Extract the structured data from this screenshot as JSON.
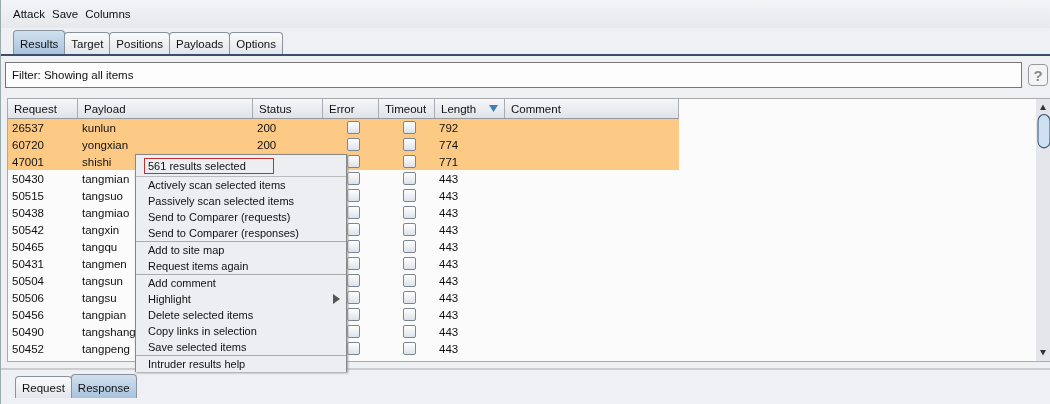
{
  "menu_bar": [
    "Attack",
    "Save",
    "Columns"
  ],
  "tabs": [
    {
      "label": "Results",
      "selected": true
    },
    {
      "label": "Target",
      "selected": false
    },
    {
      "label": "Positions",
      "selected": false
    },
    {
      "label": "Payloads",
      "selected": false
    },
    {
      "label": "Options",
      "selected": false
    }
  ],
  "filter": {
    "text": "Filter:  Showing all items",
    "help": "?"
  },
  "table": {
    "columns": [
      {
        "label": "Request",
        "sorted": false
      },
      {
        "label": "Payload",
        "sorted": false
      },
      {
        "label": "Status",
        "sorted": false
      },
      {
        "label": "Error",
        "sorted": false
      },
      {
        "label": "Timeout",
        "sorted": false
      },
      {
        "label": "Length",
        "sorted": true
      },
      {
        "label": "Comment",
        "sorted": false
      }
    ],
    "rows": [
      {
        "request": "26537",
        "payload": "kunlun",
        "status": "200",
        "error": false,
        "timeout": false,
        "length": "792",
        "selected": true
      },
      {
        "request": "60720",
        "payload": "yongxian",
        "status": "200",
        "error": false,
        "timeout": false,
        "length": "774",
        "selected": true
      },
      {
        "request": "47001",
        "payload": "shishi",
        "error": false,
        "timeout": false,
        "length": "771",
        "selected": true
      },
      {
        "request": "50430",
        "payload": "tangmian",
        "error": false,
        "timeout": false,
        "length": "443",
        "selected": false
      },
      {
        "request": "50515",
        "payload": "tangsuo",
        "error": false,
        "timeout": false,
        "length": "443",
        "selected": false
      },
      {
        "request": "50438",
        "payload": "tangmiao",
        "error": false,
        "timeout": false,
        "length": "443",
        "selected": false
      },
      {
        "request": "50542",
        "payload": "tangxin",
        "error": false,
        "timeout": false,
        "length": "443",
        "selected": false
      },
      {
        "request": "50465",
        "payload": "tangqu",
        "error": false,
        "timeout": false,
        "length": "443",
        "selected": false
      },
      {
        "request": "50431",
        "payload": "tangmen",
        "error": false,
        "timeout": false,
        "length": "443",
        "selected": false
      },
      {
        "request": "50504",
        "payload": "tangsun",
        "error": false,
        "timeout": false,
        "length": "443",
        "selected": false
      },
      {
        "request": "50506",
        "payload": "tangsu",
        "error": false,
        "timeout": false,
        "length": "443",
        "selected": false
      },
      {
        "request": "50456",
        "payload": "tangpian",
        "error": false,
        "timeout": false,
        "length": "443",
        "selected": false
      },
      {
        "request": "50490",
        "payload": "tangshang",
        "error": false,
        "timeout": false,
        "length": "443",
        "selected": false
      },
      {
        "request": "50452",
        "payload": "tangpeng",
        "error": false,
        "timeout": false,
        "length": "443",
        "selected": false
      }
    ]
  },
  "bottom_tabs": [
    {
      "label": "Request",
      "selected": false
    },
    {
      "label": "Response",
      "selected": true
    }
  ],
  "context_menu": {
    "header": "561 results selected",
    "groups": [
      [
        {
          "label": "Actively scan selected items",
          "submenu": false
        },
        {
          "label": "Passively scan selected items",
          "submenu": false
        },
        {
          "label": "Send to Comparer (requests)",
          "submenu": false
        },
        {
          "label": "Send to Comparer (responses)",
          "submenu": false
        }
      ],
      [
        {
          "label": "Add to site map",
          "submenu": false
        },
        {
          "label": "Request items again",
          "submenu": false
        }
      ],
      [
        {
          "label": "Add comment",
          "submenu": false
        },
        {
          "label": "Highlight",
          "submenu": true
        },
        {
          "label": "Delete selected items",
          "submenu": false
        },
        {
          "label": "Copy links in selection",
          "submenu": false
        },
        {
          "label": "Save selected items",
          "submenu": false
        }
      ],
      [
        {
          "label": "Intruder results help",
          "submenu": false
        }
      ]
    ]
  }
}
